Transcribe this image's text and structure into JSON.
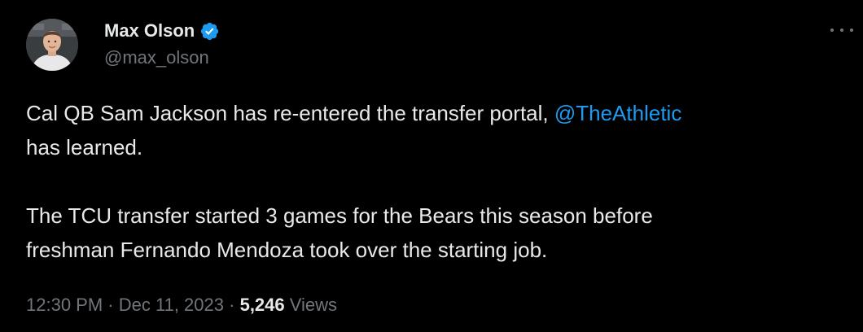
{
  "author": {
    "display_name": "Max Olson",
    "handle": "@max_olson",
    "verified": true,
    "verified_color": "#1d9bf0"
  },
  "tweet": {
    "line1_prefix": "Cal QB Sam Jackson has re-entered the transfer portal, ",
    "mention": "@TheAthletic",
    "line1_suffix": "has learned.",
    "paragraph2_line1": "The TCU transfer started 3 games for the Bears this season before",
    "paragraph2_line2": "freshman Fernando Mendoza took over the starting job."
  },
  "meta": {
    "time": "12:30 PM",
    "separator1": "·",
    "date": "Dec 11, 2023",
    "separator2": "·",
    "views_count": "5,246",
    "views_label": "Views"
  },
  "colors": {
    "background": "#000000",
    "text_primary": "#e7e9ea",
    "text_secondary": "#71767b",
    "link": "#1d9bf0"
  },
  "icons": {
    "more": "more-horizontal-icon",
    "verified": "verified-badge-icon"
  }
}
